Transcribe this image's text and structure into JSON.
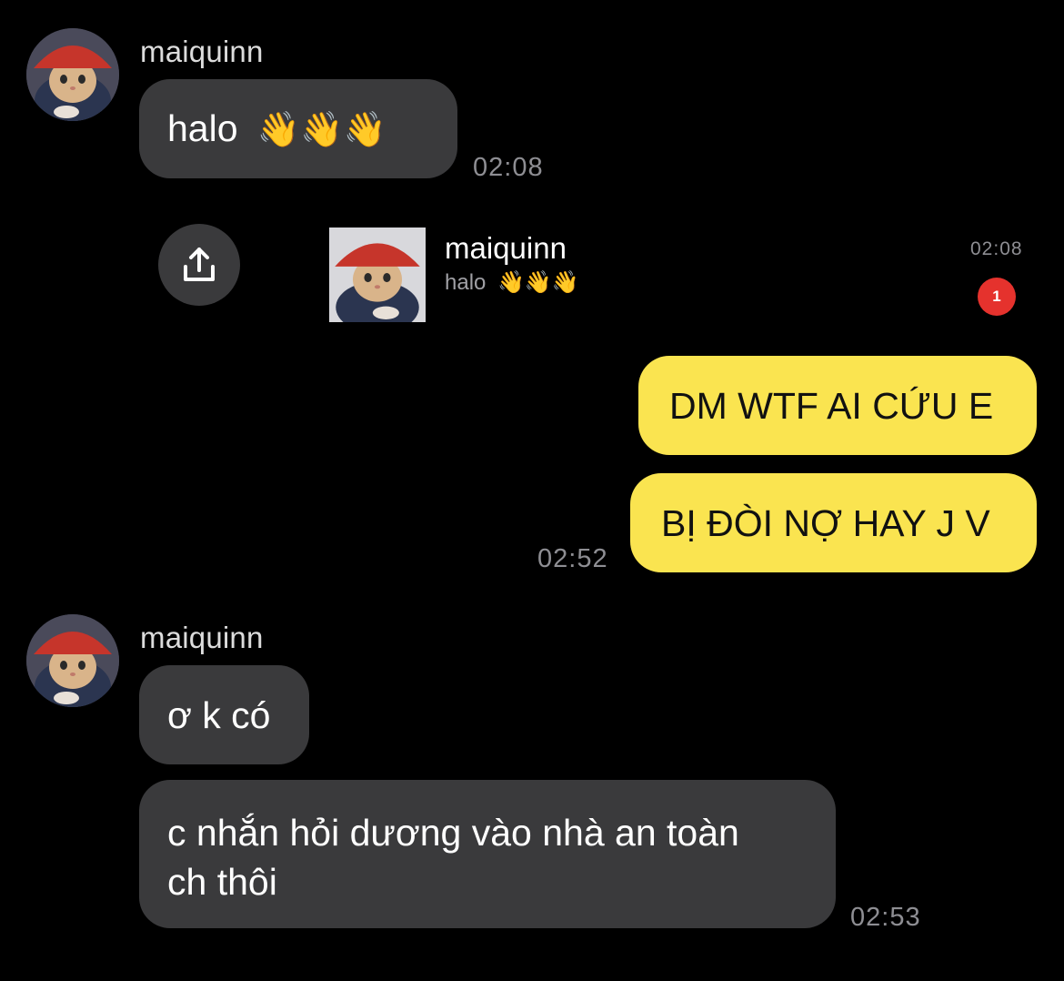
{
  "messages": {
    "m1": {
      "sender": "maiquinn",
      "text": "halo",
      "emoji": "👋👋👋",
      "time": "02:08"
    },
    "share": {
      "sender": "maiquinn",
      "preview_text": "halo",
      "preview_emoji": "👋👋👋",
      "time": "02:08",
      "badge_count": "1",
      "icon": "share-upload-icon"
    },
    "m2": {
      "text": "DM WTF AI CỨU E"
    },
    "m3": {
      "text": "BỊ ĐÒI NỢ HAY J V",
      "time": "02:52"
    },
    "m4": {
      "sender": "maiquinn",
      "text": "ơ k có"
    },
    "m5": {
      "line1": "c nhắn hỏi dương vào nhà an toàn",
      "line2": "ch thôi",
      "time": "02:53"
    }
  },
  "colors": {
    "background": "#000000",
    "incoming_bubble": "#3a3a3c",
    "outgoing_bubble": "#fae450",
    "badge": "#e5322d"
  }
}
